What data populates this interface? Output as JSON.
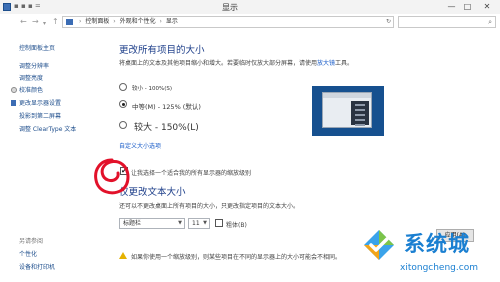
{
  "window": {
    "title": "显示",
    "minimize": "—",
    "maximize": "□",
    "close": "✕",
    "mini_icons": "▪ ▪ ▪ ="
  },
  "address": {
    "crumbs": [
      "控制面板",
      "外观和个性化",
      "显示"
    ],
    "separator": "›",
    "refresh": "↻",
    "search_placeholder": "",
    "search_icon": "⌕"
  },
  "nav": {
    "back": "←",
    "forward": "→",
    "recent": "▾",
    "up": "↑"
  },
  "sidebar": {
    "home": "控制面板主页",
    "items": [
      "调整分辨率",
      "调整亮度",
      "校准颜色",
      "更改显示器设置",
      "投影到第二屏幕",
      "调整 ClearType 文本"
    ],
    "related_heading": "另请参阅",
    "related": [
      "个性化",
      "设备和打印机"
    ]
  },
  "size_section": {
    "heading": "更改所有项目的大小",
    "desc_before": "将桌面上的文本及其他项目缩小和增大。若要临时仅放大部分屏幕，请使用",
    "magnifier_link": "放大镜",
    "desc_after": "工具。",
    "options": [
      {
        "label": "较小 - 100%(S)",
        "selected": false
      },
      {
        "label": "中等(M) - 125% (默认)",
        "selected": true
      },
      {
        "label": "较大 - 150%(L)",
        "selected": false
      }
    ],
    "custom_link": "自定义大小选项"
  },
  "scale_checkbox": {
    "label": "让我选择一个适合我的所有显示器的缩放级别",
    "checked": true
  },
  "text_section": {
    "heading": "仅更改文本大小",
    "desc": "还可以不更改桌面上所有项目的大小，只更改指定项目的文本大小。",
    "item_select": "标题栏",
    "size_select": "11",
    "bold_label": "粗体(B)",
    "bold_checked": false,
    "apply": "应用(A)"
  },
  "warning": {
    "text": "如果你使用一个缩放级别，则某些项目在不同的显示器上的大小可能会不相同。"
  },
  "watermark": {
    "brand": "系统城",
    "url": "xitongcheng.com"
  },
  "annotation": {
    "color": "#e2112a"
  }
}
